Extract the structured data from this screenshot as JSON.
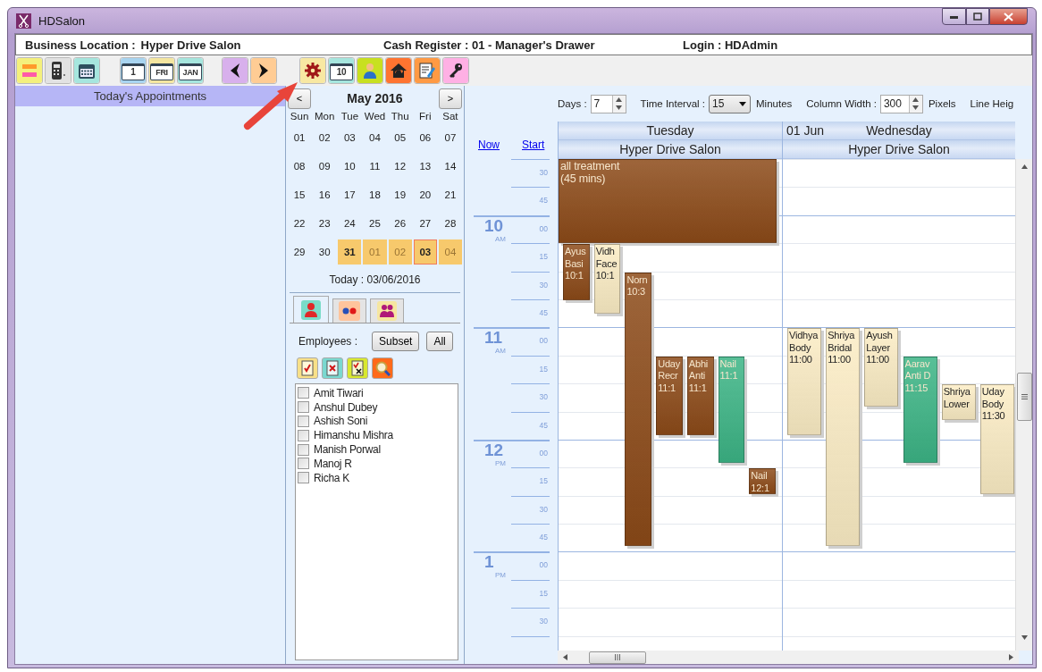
{
  "window": {
    "title": "HDSalon"
  },
  "info_bar": {
    "business_location_label": "Business Location :",
    "business_location": "Hyper Drive Salon",
    "cash_register": "Cash Register :  01 - Manager's Drawer",
    "login": "Login :  HDAdmin"
  },
  "toolbar_groups": [
    {
      "buttons": [
        {
          "kind": "stripes",
          "color": "#f4f07c"
        },
        {
          "kind": "device",
          "color": "#e2e2e2"
        },
        {
          "kind": "calendar-grid",
          "color": "#a6e6de"
        }
      ]
    },
    {
      "buttons": [
        {
          "kind": "calendar",
          "color": "#a8d4f0",
          "label": "1"
        },
        {
          "kind": "calendar",
          "color": "#f4e6a0",
          "label": "FRI"
        },
        {
          "kind": "calendar",
          "color": "#a6e6de",
          "label": "JAN"
        }
      ]
    },
    {
      "buttons": [
        {
          "kind": "back",
          "color": "#d8b0ec"
        },
        {
          "kind": "forward",
          "color": "#ffcc94"
        }
      ]
    },
    {
      "buttons": [
        {
          "kind": "gear",
          "color": "#f8e8a2"
        },
        {
          "kind": "calendar",
          "color": "#a6e6de",
          "label": "10"
        },
        {
          "kind": "person",
          "color": "#c8e020"
        },
        {
          "kind": "home",
          "color": "#ff7430"
        },
        {
          "kind": "notes",
          "color": "#ff9a44"
        },
        {
          "kind": "key",
          "color": "#ffb0e4"
        }
      ]
    }
  ],
  "todays_appointments": {
    "title": "Today's Appointments"
  },
  "calendar": {
    "prev": "<",
    "month": "May 2016",
    "next": ">",
    "weekdays": [
      "Sun",
      "Mon",
      "Tue",
      "Wed",
      "Thu",
      "Fri",
      "Sat"
    ],
    "weeks": [
      {
        "days": [
          {
            "day": "01",
            "selected": false,
            "muted": false,
            "today": false
          },
          {
            "day": "02",
            "selected": false,
            "muted": false,
            "today": false
          },
          {
            "day": "03",
            "selected": false,
            "muted": false,
            "today": false
          },
          {
            "day": "04",
            "selected": false,
            "muted": false,
            "today": false
          },
          {
            "day": "05",
            "selected": false,
            "muted": false,
            "today": false
          },
          {
            "day": "06",
            "selected": false,
            "muted": false,
            "today": false
          },
          {
            "day": "07",
            "selected": false,
            "muted": false,
            "today": false
          }
        ]
      },
      {
        "days": [
          {
            "day": "08",
            "selected": false,
            "muted": false,
            "today": false
          },
          {
            "day": "09",
            "selected": false,
            "muted": false,
            "today": false
          },
          {
            "day": "10",
            "selected": false,
            "muted": false,
            "today": false
          },
          {
            "day": "11",
            "selected": false,
            "muted": false,
            "today": false
          },
          {
            "day": "12",
            "selected": false,
            "muted": false,
            "today": false
          },
          {
            "day": "13",
            "selected": false,
            "muted": false,
            "today": false
          },
          {
            "day": "14",
            "selected": false,
            "muted": false,
            "today": false
          }
        ]
      },
      {
        "days": [
          {
            "day": "15",
            "selected": false,
            "muted": false,
            "today": false
          },
          {
            "day": "16",
            "selected": false,
            "muted": false,
            "today": false
          },
          {
            "day": "17",
            "selected": false,
            "muted": false,
            "today": false
          },
          {
            "day": "18",
            "selected": false,
            "muted": false,
            "today": false
          },
          {
            "day": "19",
            "selected": false,
            "muted": false,
            "today": false
          },
          {
            "day": "20",
            "selected": false,
            "muted": false,
            "today": false
          },
          {
            "day": "21",
            "selected": false,
            "muted": false,
            "today": false
          }
        ]
      },
      {
        "days": [
          {
            "day": "22",
            "selected": false,
            "muted": false,
            "today": false
          },
          {
            "day": "23",
            "selected": false,
            "muted": false,
            "today": false
          },
          {
            "day": "24",
            "selected": false,
            "muted": false,
            "today": false
          },
          {
            "day": "25",
            "selected": false,
            "muted": false,
            "today": false
          },
          {
            "day": "26",
            "selected": false,
            "muted": false,
            "today": false
          },
          {
            "day": "27",
            "selected": false,
            "muted": false,
            "today": false
          },
          {
            "day": "28",
            "selected": false,
            "muted": false,
            "today": false
          }
        ]
      },
      {
        "days": [
          {
            "day": "29",
            "selected": false,
            "muted": false,
            "today": false
          },
          {
            "day": "30",
            "selected": false,
            "muted": false,
            "today": false
          },
          {
            "day": "31",
            "selected": true,
            "muted": false,
            "today": false
          },
          {
            "day": "01",
            "selected": true,
            "muted": true,
            "today": false
          },
          {
            "day": "02",
            "selected": true,
            "muted": true,
            "today": false
          },
          {
            "day": "03",
            "selected": true,
            "muted": false,
            "today": true
          },
          {
            "day": "04",
            "selected": true,
            "muted": true,
            "today": false
          }
        ]
      }
    ],
    "today_label": "Today : 03/06/2016"
  },
  "resource_tabs": [
    {
      "kind": "employee",
      "selected": true
    },
    {
      "kind": "dots",
      "selected": false
    },
    {
      "kind": "group",
      "selected": false
    }
  ],
  "employees": {
    "label": "Employees :",
    "buttons": [
      "Subset",
      "All"
    ],
    "actions": [
      {
        "kind": "check-all"
      },
      {
        "kind": "uncheck-all"
      },
      {
        "kind": "invert"
      },
      {
        "kind": "search"
      }
    ],
    "list": [
      {
        "name": "Amit Tiwari",
        "checked": false
      },
      {
        "name": "Anshul Dubey",
        "checked": false
      },
      {
        "name": "Ashish Soni",
        "checked": false
      },
      {
        "name": "Himanshu Mishra",
        "checked": false
      },
      {
        "name": "Manish Porwal",
        "checked": false
      },
      {
        "name": "Manoj R",
        "checked": false
      },
      {
        "name": "Richa K",
        "checked": false
      }
    ]
  },
  "schedule": {
    "settings": [
      {
        "kind": "spinner",
        "label": "Days :",
        "value": "7"
      },
      {
        "kind": "dropdown",
        "label": "Time Interval :",
        "value": "15",
        "unit": "Minutes"
      },
      {
        "kind": "spinner",
        "label": "Column Width :",
        "value": "300",
        "unit": "Pixels"
      },
      {
        "kind": "label",
        "label": "Line Heig"
      }
    ],
    "links": [
      "Now",
      "Start"
    ],
    "time_slots": [
      {
        "minute": "30"
      },
      {
        "minute": "45"
      },
      {
        "hour": "10",
        "meridiem": "AM",
        "minute": "00"
      },
      {
        "minute": "15"
      },
      {
        "minute": "30"
      },
      {
        "minute": "45"
      },
      {
        "hour": "11",
        "meridiem": "AM",
        "minute": "00"
      },
      {
        "minute": "15"
      },
      {
        "minute": "30"
      },
      {
        "minute": "45"
      },
      {
        "hour": "12",
        "meridiem": "PM",
        "minute": "00"
      },
      {
        "minute": "15"
      },
      {
        "minute": "30"
      },
      {
        "minute": "45"
      },
      {
        "hour": "1",
        "meridiem": "PM",
        "minute": "00"
      },
      {
        "minute": "15"
      },
      {
        "minute": "30"
      }
    ],
    "days": [
      {
        "day": "Tuesday",
        "location": "Hyper Drive Salon",
        "wide_events": [
          {
            "lines": [
              "all treatment",
              "(45 mins)"
            ],
            "color": "#8c4a18"
          }
        ],
        "lanes": [
          {
            "events": [
              {
                "lines": [
                  "Ayus",
                  "Basi",
                  "10:1"
                ],
                "color": "#8c4a18"
              }
            ]
          },
          {
            "events": [
              {
                "lines": [
                  "Vidh",
                  "Face",
                  "10:1"
                ],
                "color": "#fbecc4"
              }
            ]
          },
          {
            "events": [
              {
                "lines": [
                  "Norn",
                  "10:3"
                ],
                "color": "#8c4a18"
              }
            ]
          },
          {
            "events": [
              {
                "lines": [
                  "Uday",
                  "Recr",
                  "11:1"
                ],
                "color": "#8c4a18"
              }
            ]
          },
          {
            "events": [
              {
                "lines": [
                  "Abhi",
                  "Anti",
                  "11:1"
                ],
                "color": "#8c4a18"
              }
            ]
          },
          {
            "events": [
              {
                "lines": [
                  "Nail",
                  "11:1"
                ],
                "color": "#3cb485"
              }
            ]
          },
          {
            "events": [
              {
                "lines": [
                  "Nail",
                  "12:1"
                ],
                "color": "#8c4a18"
              }
            ]
          }
        ]
      },
      {
        "date": "01 Jun",
        "day": "Wednesday",
        "location": "Hyper Drive Salon",
        "lanes": [
          {
            "events": [
              {
                "lines": [
                  "Vidhya",
                  "Body",
                  "11:00"
                ],
                "color": "#fbecc4"
              }
            ]
          },
          {
            "events": [
              {
                "lines": [
                  "Shriya",
                  "Bridal",
                  "11:00"
                ],
                "color": "#fbecc4"
              }
            ]
          },
          {
            "events": [
              {
                "lines": [
                  "Ayush",
                  "Layer",
                  "11:00"
                ],
                "color": "#fbecc4"
              }
            ]
          },
          {
            "events": [
              {
                "lines": [
                  "Aarav",
                  "Anti D",
                  "11:15"
                ],
                "color": "#3cb485"
              }
            ]
          },
          {
            "events": [
              {
                "lines": [
                  "Shriya",
                  "Lower"
                ],
                "color": "#fbecc4"
              }
            ]
          },
          {
            "events": [
              {
                "lines": [
                  "Uday",
                  "Body",
                  "11:30"
                ],
                "color": "#fbecc4"
              }
            ]
          }
        ]
      }
    ]
  }
}
